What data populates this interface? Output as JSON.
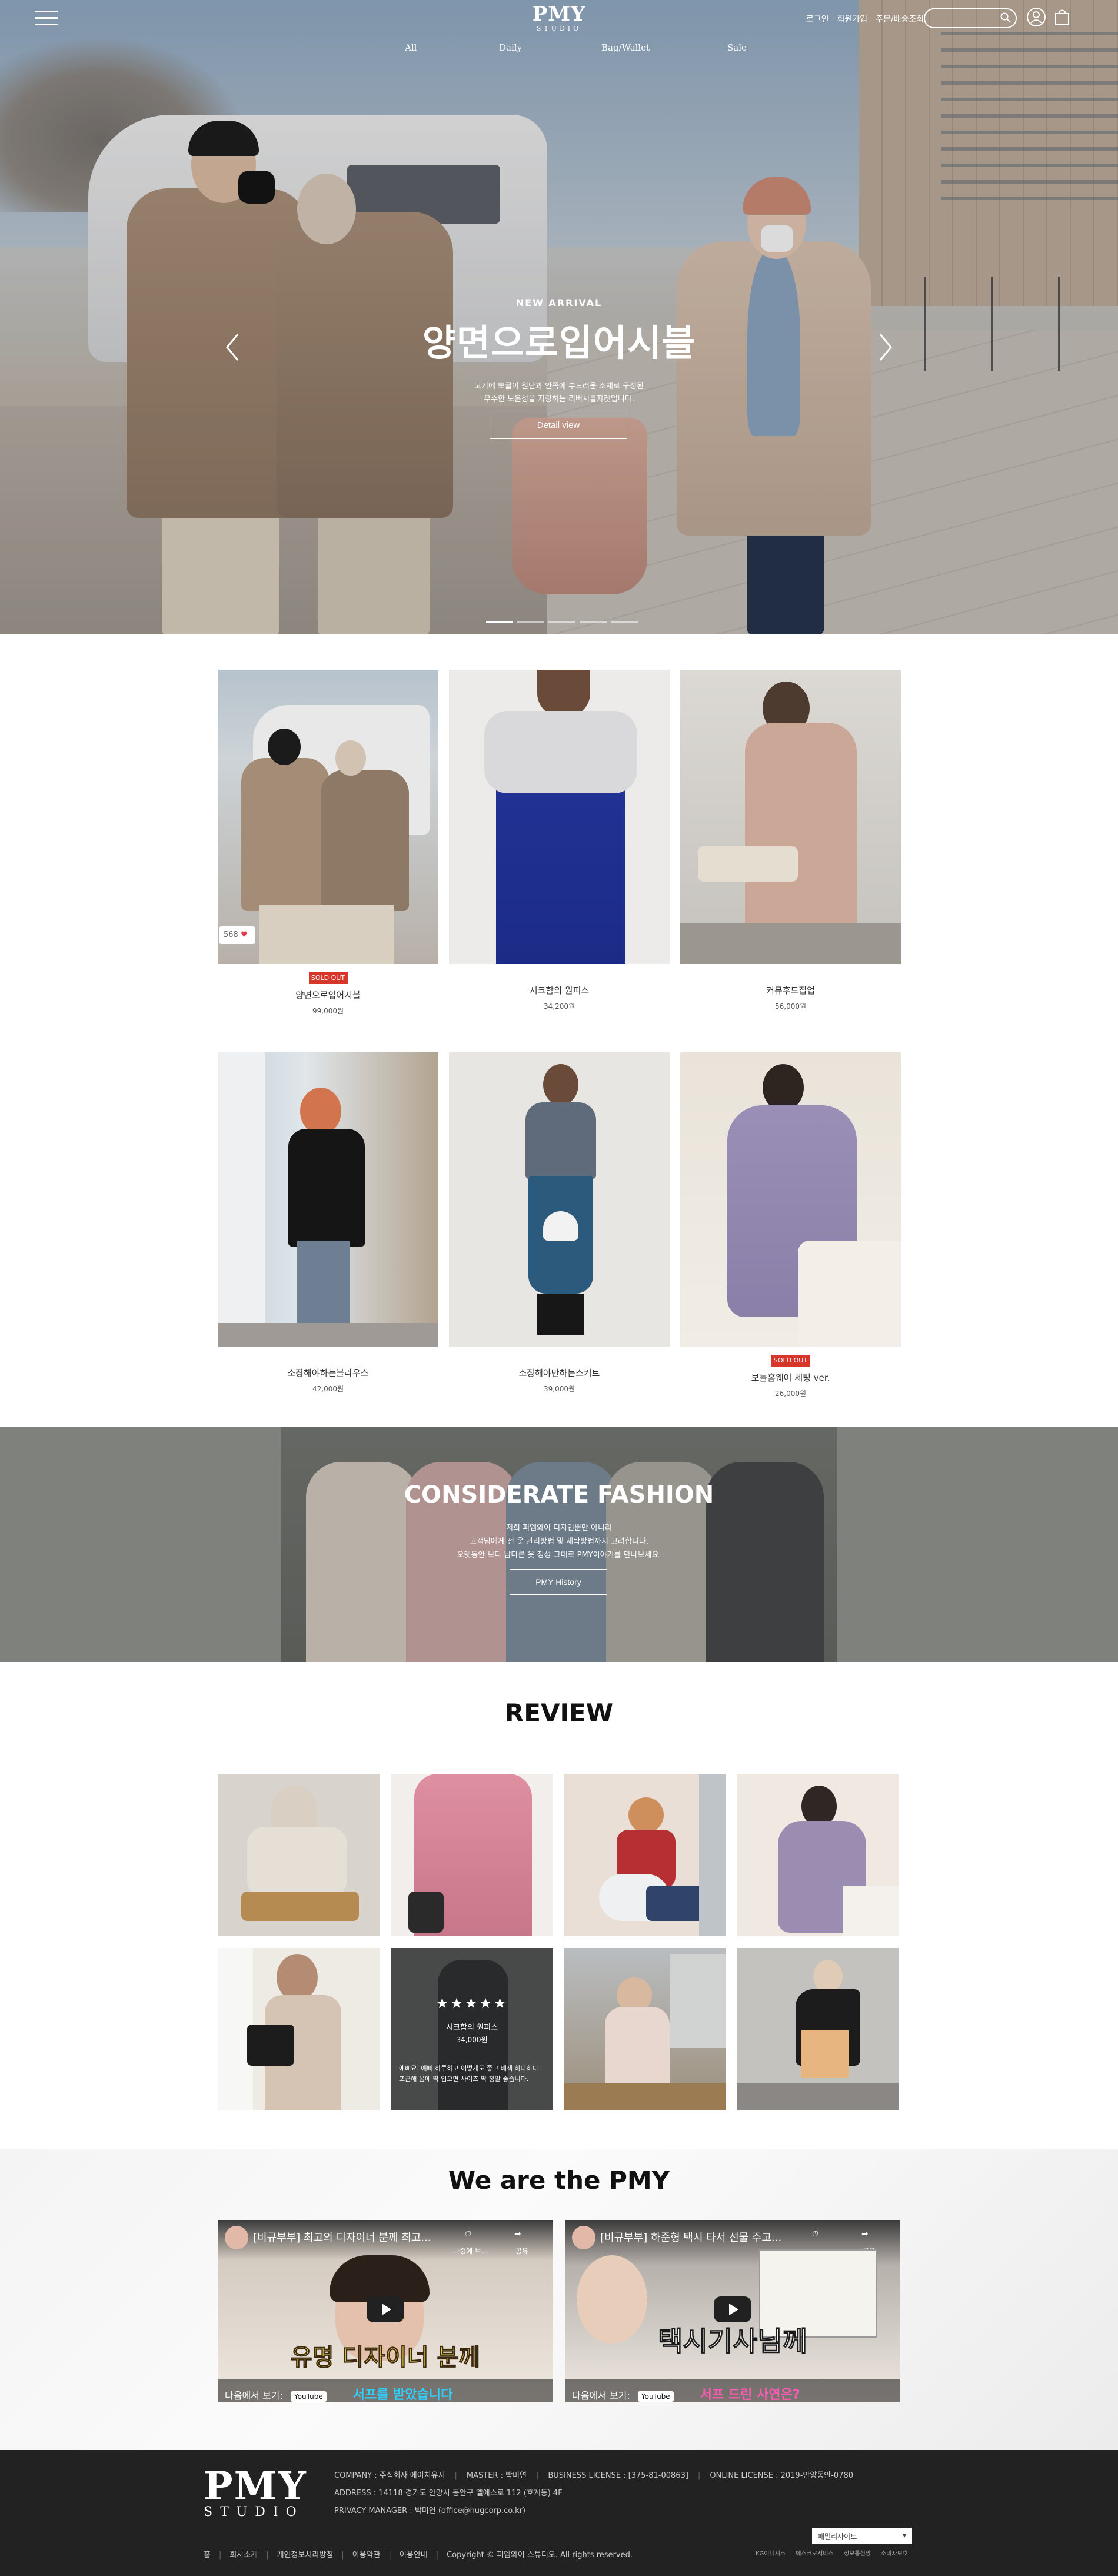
{
  "header": {
    "logo_main": "PMY",
    "logo_sub": "STUDIO",
    "top_links": [
      "로그인",
      "회원가입",
      "주문/배송조회"
    ],
    "search_placeholder": "",
    "nav": [
      "All",
      "Daily",
      "Bag/Wallet",
      "Sale"
    ]
  },
  "hero": {
    "kicker": "NEW ARRIVAL",
    "title": "양면으로입어시블",
    "desc_line1": "고기에 뽀글이 원단과 안쪽에 부드러운 소재로 구성된",
    "desc_line2": "우수한 보온성을 자랑하는 리버시블자켓입니다.",
    "button": "Detail view",
    "slide_count": 5,
    "active_slide": 1
  },
  "products": [
    {
      "name": "양면으로입어시블",
      "price": "99,000원",
      "sold_out": true,
      "likes": "568"
    },
    {
      "name": "시크함의 원피스",
      "price": "34,200원",
      "sold_out": false
    },
    {
      "name": "커뮤후드집업",
      "price": "56,000원",
      "sold_out": false
    },
    {
      "name": "소장해야하는블라우스",
      "price": "42,000원",
      "sold_out": false
    },
    {
      "name": "소장해야만하는스커트",
      "price": "39,000원",
      "sold_out": false
    },
    {
      "name": "보들홈웨어 세팅 ver.",
      "price": "26,000원",
      "sold_out": true
    }
  ],
  "badges": {
    "sold_out": "SOLD OUT"
  },
  "banner": {
    "title": "CONSIDERATE FASHION",
    "line1": "저희 피엠와이 디자인뿐만 아니라",
    "line2": "고객님에게 전 옷 관리방법 및 세탁방법까지 고려합니다.",
    "line3": "오랫동안 보다 남다른 옷 정성 그대로 PMY이야기를 만나보세요.",
    "button": "PMY History"
  },
  "review": {
    "title": "REVIEW",
    "overlay": {
      "stars": "★★★★★",
      "product": "시크함의 원피스",
      "price": "34,000원",
      "text": "예뻐요. 예뻐 하루하고 어떻게도 좋고 배색 하나하나 포근해 몸에 딱 입으면 사이즈 딱 정말 좋습니다."
    }
  },
  "pmy": {
    "title": "We are the PMY",
    "videos": [
      {
        "title": "[비규부부] 최고의 디자이너 분께 최고...",
        "caption_top": "유명 디자이너 분께",
        "caption_bottom": "서프를 받았습니다",
        "next_label": "다음에서 보기:",
        "yt": "YouTube",
        "share": "공유",
        "later": "나중에 보..."
      },
      {
        "title": "[비규부부] 하준형 택시 타서 선물 주고...",
        "caption_top": "택시기사님께",
        "caption_bottom": "서프 드린 사연은?",
        "next_label": "다음에서 보기:",
        "yt": "YouTube",
        "share": "공유",
        "later": ""
      }
    ]
  },
  "footer": {
    "company": "COMPANY : 주식회사 에이치유지",
    "master": "MASTER : 박미연",
    "business": "BUSINESS LICENSE : [375-81-00863]",
    "online": "ONLINE LICENSE : 2019-안양동안-0780",
    "address": "ADDRESS : 14118 경기도 안양시 동안구 엘에스로 112 (호계동) 4F",
    "privacy": "PRIVACY MANAGER : 박미연 (office@hugcorp.co.kr)",
    "links": [
      "홈",
      "회사소개",
      "개인정보처리방침",
      "이용약관",
      "이용안내"
    ],
    "copyright": "Copyright © 피엠와이 스튜디오. All rights reserved.",
    "family_site": "패밀리사이트",
    "badges": [
      "KG이니시스",
      "에스크로서비스",
      "정보통신망",
      "소비자보호"
    ]
  },
  "colors": {
    "accent_soldout": "#d9362b",
    "footer_bg": "#222222",
    "like_heart": "#e33a4c"
  }
}
